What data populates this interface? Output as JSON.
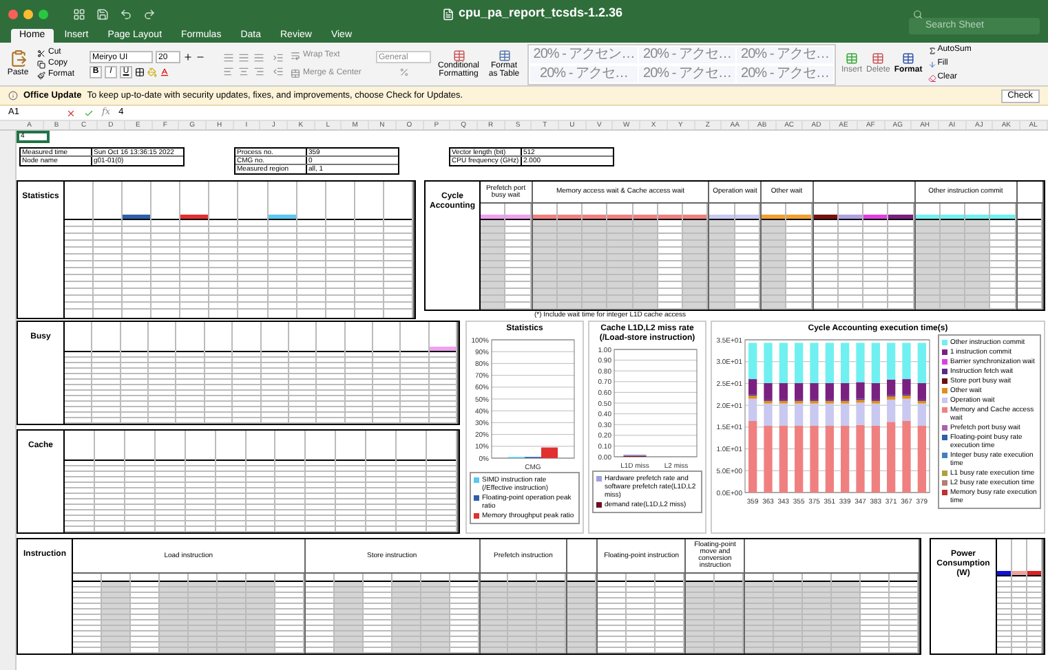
{
  "window": {
    "title": "cpu_pa_report_tcsds-1.2.36",
    "search_placeholder": "Search Sheet"
  },
  "tabs": [
    {
      "label": "Home",
      "selected": true
    },
    {
      "label": "Insert",
      "selected": false
    },
    {
      "label": "Page Layout",
      "selected": false
    },
    {
      "label": "Formulas",
      "selected": false
    },
    {
      "label": "Data",
      "selected": false
    },
    {
      "label": "Review",
      "selected": false
    },
    {
      "label": "View",
      "selected": false
    }
  ],
  "ribbon": {
    "paste": "Paste",
    "clipboard": [
      "Cut",
      "Copy",
      "Format"
    ],
    "font": "Meiryo UI",
    "font_size": "20",
    "bold": "B",
    "italic": "I",
    "underline": "U",
    "wrap": "Wrap Text",
    "merge": "Merge & Center",
    "number_format": "General",
    "conditional": "Conditional Formatting",
    "format_table": "Format as Table",
    "styles": [
      "20% - アクセン…",
      "20% - アクセ…",
      "20% - アクセ…",
      "20% - アクセ…",
      "20% - アクセ…",
      "20% - アクセ…"
    ],
    "cells": [
      "Insert",
      "Delete",
      "Format"
    ],
    "editing": [
      "AutoSum",
      "Fill",
      "Clear"
    ]
  },
  "update_bar": {
    "title": "Office Update",
    "message": "To keep up-to-date with security updates, fixes, and improvements, choose Check for Updates.",
    "button": "Check"
  },
  "formula_bar": {
    "cell": "A1",
    "fx": "fx",
    "value": "4"
  },
  "column_headers": [
    "A",
    "B",
    "C",
    "D",
    "E",
    "F",
    "G",
    "H",
    "I",
    "J",
    "K",
    "L",
    "M",
    "N",
    "O",
    "P",
    "Q",
    "R",
    "S",
    "T",
    "U",
    "V",
    "W",
    "X",
    "Y",
    "Z",
    "AA",
    "AB",
    "AC",
    "AD",
    "AE",
    "AF",
    "AG",
    "AH",
    "AI",
    "AJ",
    "AK",
    "AL"
  ],
  "sheet": {
    "a1": "4",
    "info": [
      [
        {
          "label": "Measured time",
          "value": "Sun Oct 16 13:36:15 2022"
        },
        {
          "label": "Node name",
          "value": "g01-01(0)"
        }
      ],
      [
        {
          "label": "Process no.",
          "value": "359"
        },
        {
          "label": "CMG no.",
          "value": "0"
        },
        {
          "label": "Measured region",
          "value": "all, 1"
        }
      ],
      [
        {
          "label": "Vector length (bit)",
          "value": "512"
        },
        {
          "label": "CPU frequency (GHz)",
          "value": "2.000"
        }
      ]
    ],
    "statistics": {
      "title": "Statistics",
      "groups": [
        {
          "columns": [
            {
              "shaded": false
            },
            {
              "shaded": false
            },
            {
              "shaded": false,
              "color": "#2e5fa8"
            },
            {
              "shaded": false
            },
            {
              "shaded": false,
              "color": "#e03030"
            },
            {
              "shaded": false
            },
            {
              "shaded": false
            },
            {
              "shaded": false,
              "color": "#5bc8f0"
            },
            {
              "shaded": false
            },
            {
              "shaded": false
            },
            {
              "shaded": false
            },
            {
              "shaded": false
            }
          ]
        }
      ]
    },
    "cycle_accounting": {
      "title": "Cycle Accounting",
      "groups": [
        {
          "label": "Prefetch port busy wait",
          "columns": [
            {
              "shaded": true,
              "color": "#f0a0f0"
            },
            {
              "shaded": false,
              "color": "#f0a0f0"
            }
          ]
        },
        {
          "label": "Memory access wait & Cache access wait",
          "columns": [
            {
              "shaded": true,
              "color": "#f08080"
            },
            {
              "shaded": true,
              "color": "#f08080"
            },
            {
              "shaded": true,
              "color": "#f08080"
            },
            {
              "shaded": true,
              "color": "#f08080"
            },
            {
              "shaded": true,
              "color": "#f08080"
            },
            {
              "shaded": false,
              "color": "#f08080"
            },
            {
              "shaded": true,
              "color": "#f08080"
            }
          ]
        },
        {
          "label": "Operation wait",
          "columns": [
            {
              "shaded": true,
              "color": "#c8c8f0"
            },
            {
              "shaded": false,
              "color": "#c8c8f0"
            }
          ]
        },
        {
          "label": "Other wait",
          "columns": [
            {
              "shaded": true,
              "color": "#f0a030"
            },
            {
              "shaded": false,
              "color": "#f0a030"
            }
          ]
        },
        {
          "columns": [
            {
              "shaded": false,
              "color": "#7a1010"
            },
            {
              "shaded": false,
              "color": "#b0a0e0"
            },
            {
              "shaded": false,
              "color": "#e040e0"
            },
            {
              "shaded": false,
              "color": "#7a2080"
            }
          ]
        },
        {
          "label": "Other instruction commit",
          "columns": [
            {
              "shaded": true,
              "color": "#70f0f0"
            },
            {
              "shaded": true,
              "color": "#70f0f0"
            },
            {
              "shaded": true,
              "color": "#70f0f0"
            },
            {
              "shaded": false,
              "color": "#70f0f0"
            }
          ]
        },
        {
          "columns": [
            {
              "shaded": false
            }
          ]
        }
      ],
      "note": "(*) Include wait time for integer L1D cache access"
    },
    "busy": {
      "title": "Busy",
      "groups": [
        {
          "columns": [
            {
              "shaded": false
            },
            {
              "shaded": false
            },
            {
              "shaded": false
            },
            {
              "shaded": false
            },
            {
              "shaded": false
            },
            {
              "shaded": false
            },
            {
              "shaded": false
            },
            {
              "shaded": false
            },
            {
              "shaded": false
            },
            {
              "shaded": false
            },
            {
              "shaded": false
            },
            {
              "shaded": false
            },
            {
              "shaded": false
            },
            {
              "shaded": false,
              "color": "#f0a0f0"
            }
          ]
        }
      ]
    },
    "cache": {
      "title": "Cache",
      "groups": [
        {
          "columns": [
            {
              "shaded": false
            },
            {
              "shaded": false
            },
            {
              "shaded": false
            },
            {
              "shaded": false
            },
            {
              "shaded": false
            },
            {
              "shaded": false
            },
            {
              "shaded": false
            },
            {
              "shaded": false
            },
            {
              "shaded": false
            },
            {
              "shaded": false
            },
            {
              "shaded": false
            },
            {
              "shaded": false
            },
            {
              "shaded": false
            }
          ]
        }
      ]
    },
    "instruction": {
      "title": "Instruction",
      "groups": [
        {
          "label": "Load instruction",
          "columns": [
            {
              "shaded": false
            },
            {
              "shaded": true
            },
            {
              "shaded": false
            },
            {
              "shaded": true
            },
            {
              "shaded": true
            },
            {
              "shaded": true
            },
            {
              "shaded": true
            },
            {
              "shaded": false
            }
          ]
        },
        {
          "label": "Store instruction",
          "columns": [
            {
              "shaded": false
            },
            {
              "shaded": true
            },
            {
              "shaded": false
            },
            {
              "shaded": true
            },
            {
              "shaded": true
            },
            {
              "shaded": false
            }
          ]
        },
        {
          "label": "Prefetch instruction",
          "columns": [
            {
              "shaded": true
            },
            {
              "shaded": true
            },
            {
              "shaded": true
            }
          ]
        },
        {
          "columns": [
            {
              "shaded": true
            }
          ]
        },
        {
          "label": "Floating-point instruction",
          "columns": [
            {
              "shaded": false
            },
            {
              "shaded": false
            },
            {
              "shaded": false
            }
          ]
        },
        {
          "label": "Floating-point move and conversion instruction",
          "columns": [
            {
              "shaded": true
            },
            {
              "shaded": true
            }
          ]
        },
        {
          "columns": [
            {
              "shaded": true
            },
            {
              "shaded": true
            },
            {
              "shaded": true
            },
            {
              "shaded": true
            },
            {
              "shaded": false
            },
            {
              "shaded": false
            }
          ]
        }
      ]
    },
    "power": {
      "title": "Power Consumption (W)",
      "groups": [
        {
          "columns": [
            {
              "shaded": false,
              "color": "#1010e0"
            },
            {
              "shaded": false,
              "color": "#f0a0a0"
            },
            {
              "shaded": false,
              "color": "#e02020"
            }
          ]
        }
      ]
    },
    "charts": [
      {
        "chart_data": {
          "type": "bar",
          "title": "Statistics",
          "categories": [
            "CMG"
          ],
          "yticks": [
            {
              "value": 0,
              "label": "0%"
            },
            {
              "value": 10,
              "label": "10%"
            },
            {
              "value": 20,
              "label": "20%"
            },
            {
              "value": 30,
              "label": "30%"
            },
            {
              "value": 40,
              "label": "40%"
            },
            {
              "value": 50,
              "label": "50%"
            },
            {
              "value": 60,
              "label": "60%"
            },
            {
              "value": 70,
              "label": "70%"
            },
            {
              "value": 80,
              "label": "80%"
            },
            {
              "value": 90,
              "label": "90%"
            },
            {
              "value": 100,
              "label": "100%"
            }
          ],
          "ylim": [
            0,
            100
          ],
          "stacked": false,
          "grid": true,
          "legend": "bottom",
          "series": [
            {
              "name": "SIMD instruction rate (/Effective instruction)",
              "color": "#5bc8f0",
              "values": [
                1
              ]
            },
            {
              "name": "Floating-point operation peak ratio",
              "color": "#2e5fa8",
              "values": [
                1
              ]
            },
            {
              "name": "Memory throughput peak ratio",
              "color": "#e03030",
              "values": [
                9
              ]
            }
          ]
        }
      },
      {
        "chart_data": {
          "type": "bar",
          "title": "Cache L1D,L2 miss rate (/Load-store instruction)",
          "categories": [
            "L1D miss",
            "L2 miss"
          ],
          "yticks": [
            {
              "value": 0,
              "label": "0.00"
            },
            {
              "value": 0.1,
              "label": "0.10"
            },
            {
              "value": 0.2,
              "label": "0.20"
            },
            {
              "value": 0.3,
              "label": "0.30"
            },
            {
              "value": 0.4,
              "label": "0.40"
            },
            {
              "value": 0.5,
              "label": "0.50"
            },
            {
              "value": 0.6,
              "label": "0.60"
            },
            {
              "value": 0.7,
              "label": "0.70"
            },
            {
              "value": 0.8,
              "label": "0.80"
            },
            {
              "value": 0.9,
              "label": "0.90"
            },
            {
              "value": 1,
              "label": "1.00"
            }
          ],
          "ylim": [
            0,
            1
          ],
          "stacked": true,
          "grid": true,
          "legend": "bottom",
          "series": [
            {
              "name": "Hardware prefetch rate and software prefetch rate(L1D,L2 miss)",
              "color": "#a0a0e0",
              "values": [
                0.01,
                0
              ]
            },
            {
              "name": "demand rate(L1D,L2 miss)",
              "color": "#6a1020",
              "values": [
                0.01,
                0
              ]
            }
          ]
        }
      },
      {
        "chart_data": {
          "type": "bar",
          "title": "Cycle Accounting execution time(s)",
          "categories": [
            "359",
            "363",
            "343",
            "355",
            "375",
            "351",
            "339",
            "347",
            "383",
            "371",
            "367",
            "379"
          ],
          "yticks": [
            {
              "value": 0,
              "label": "0.0E+00"
            },
            {
              "value": 5,
              "label": "5.0E+00"
            },
            {
              "value": 10,
              "label": "1.0E+01"
            },
            {
              "value": 15,
              "label": "1.5E+01"
            },
            {
              "value": 20,
              "label": "2.0E+01"
            },
            {
              "value": 25,
              "label": "2.5E+01"
            },
            {
              "value": 30,
              "label": "3.0E+01"
            },
            {
              "value": 35,
              "label": "3.5E+01"
            }
          ],
          "ylim": [
            0,
            35
          ],
          "stacked": true,
          "grid": true,
          "legend": "right",
          "series": [
            {
              "name": "Other instruction commit",
              "color": "#70f0f0",
              "values": [
                8.3,
                9.2,
                9.2,
                9.2,
                9.2,
                9.2,
                9.2,
                9.0,
                9.2,
                8.4,
                8.3,
                9.2
              ]
            },
            {
              "name": "1 instruction commit",
              "color": "#7a2080",
              "values": [
                3.5,
                3.8,
                3.8,
                3.8,
                3.8,
                3.8,
                3.8,
                3.8,
                3.8,
                3.6,
                3.5,
                3.8
              ]
            },
            {
              "name": "Barrier synchronization wait",
              "color": "#e040e0",
              "values": [
                0,
                0,
                0,
                0,
                0,
                0,
                0,
                0,
                0,
                0,
                0,
                0
              ]
            },
            {
              "name": "Instruction fetch wait",
              "color": "#5a2a8a",
              "values": [
                0.3,
                0.3,
                0.3,
                0.3,
                0.3,
                0.3,
                0.3,
                0.3,
                0.3,
                0.3,
                0.3,
                0.3
              ]
            },
            {
              "name": "Store port busy wait",
              "color": "#6a1010",
              "values": [
                0,
                0,
                0,
                0,
                0,
                0,
                0,
                0,
                0,
                0,
                0,
                0
              ]
            },
            {
              "name": "Other wait",
              "color": "#e0901a",
              "values": [
                0.7,
                0.6,
                0.6,
                0.6,
                0.6,
                0.6,
                0.6,
                0.6,
                0.6,
                0.7,
                0.7,
                0.6
              ]
            },
            {
              "name": "Operation wait",
              "color": "#c8c8f0",
              "values": [
                5.1,
                5.1,
                5.1,
                5.1,
                5.1,
                5.1,
                5.1,
                5.1,
                5.1,
                5.1,
                5.1,
                5.1
              ]
            },
            {
              "name": "Memory and Cache access wait",
              "color": "#f08080",
              "values": [
                16.4,
                15.3,
                15.3,
                15.3,
                15.3,
                15.3,
                15.3,
                15.5,
                15.3,
                16.2,
                16.4,
                15.3
              ]
            },
            {
              "name": "Prefetch port busy wait",
              "color": "#b060b0",
              "values": [
                0,
                0,
                0,
                0,
                0,
                0,
                0,
                0,
                0,
                0,
                0,
                0
              ]
            },
            {
              "name": "Floating-point busy rate execution time",
              "color": "#2e5fa8",
              "values": [
                null,
                null,
                null,
                null,
                null,
                null,
                null,
                null,
                null,
                null,
                null,
                null
              ]
            },
            {
              "name": "Integer busy rate execution time",
              "color": "#4080c0",
              "values": [
                null,
                null,
                null,
                null,
                null,
                null,
                null,
                null,
                null,
                null,
                null,
                null
              ]
            },
            {
              "name": "L1 busy rate execution time",
              "color": "#b0a040",
              "values": [
                null,
                null,
                null,
                null,
                null,
                null,
                null,
                null,
                null,
                null,
                null,
                null
              ]
            },
            {
              "name": "L2 busy rate execution time",
              "color": "#b08070",
              "values": [
                null,
                null,
                null,
                null,
                null,
                null,
                null,
                null,
                null,
                null,
                null,
                null
              ]
            },
            {
              "name": "Memory busy rate execution time",
              "color": "#c03030",
              "values": [
                null,
                null,
                null,
                null,
                null,
                null,
                null,
                null,
                null,
                null,
                null,
                null
              ]
            }
          ]
        }
      }
    ]
  }
}
